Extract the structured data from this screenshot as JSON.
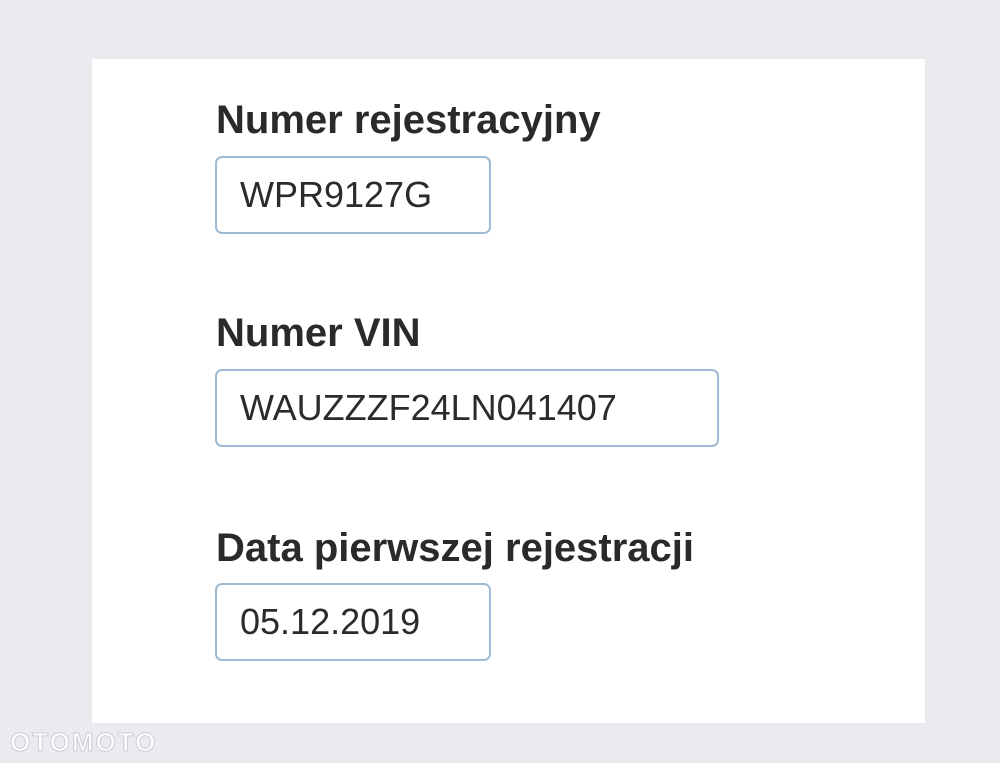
{
  "form": {
    "registration": {
      "label": "Numer rejestracyjny",
      "value": "WPR9127G"
    },
    "vin": {
      "label": "Numer VIN",
      "value": "WAUZZZF24LN041407"
    },
    "first_registration": {
      "label": "Data pierwszej rejestracji",
      "value": "05.12.2019"
    }
  },
  "watermark": {
    "text": "OTOMOTO"
  }
}
